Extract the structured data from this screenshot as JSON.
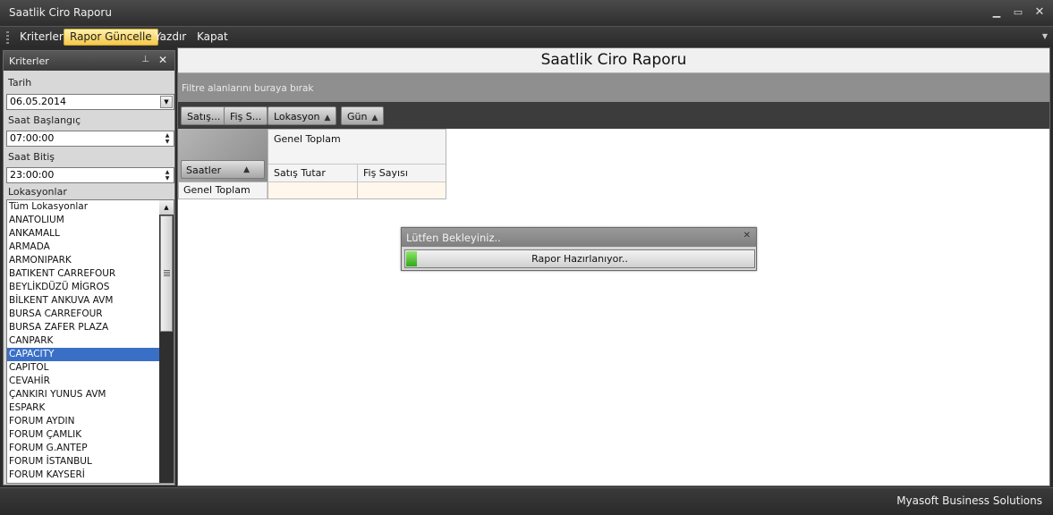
{
  "window": {
    "title": "Saatlik Ciro Raporu"
  },
  "menu": {
    "items": [
      {
        "label": "Kriterler",
        "active": false
      },
      {
        "label": "Rapor Güncelle",
        "active": true
      },
      {
        "label": "Yazdır",
        "active": false
      },
      {
        "label": "Kapat",
        "active": false
      }
    ]
  },
  "criteria": {
    "panel_title": "Kriterler",
    "date_label": "Tarih",
    "date_value": "06.05.2014",
    "start_label": "Saat Başlangıç",
    "start_value": "07:00:00",
    "end_label": "Saat Bitiş",
    "end_value": "23:00:00",
    "locations_label": "Lokasyonlar",
    "locations": [
      "Tüm Lokasyonlar",
      "ANATOLIUM",
      "ANKAMALL",
      "ARMADA",
      "ARMONIPARK",
      "BATIKENT CARREFOUR",
      "BEYLİKDÜZÜ MİGROS",
      "BİLKENT ANKUVA AVM",
      "BURSA CARREFOUR",
      "BURSA ZAFER PLAZA",
      "CANPARK",
      "CAPACITY",
      "CAPITOL",
      "CEVAHİR",
      "ÇANKIRI YUNUS AVM",
      "ESPARK",
      "FORUM AYDIN",
      "FORUM ÇAMLIK",
      "FORUM G.ANTEP",
      "FORUM İSTANBUL",
      "FORUM KAYSERİ"
    ],
    "selected_location": "CAPACITY"
  },
  "report": {
    "title": "Saatlik Ciro Raporu",
    "filter_hint": "Filtre alanlarını buraya bırak",
    "column_fields": [
      "Satış...",
      "Fiş S...",
      "Lokasyon",
      "Gün"
    ],
    "row_field": "Saatler",
    "grand_total_col": "Genel Toplam",
    "measure_1": "Satış Tutar",
    "measure_2": "Fiş Sayısı",
    "grand_total_row": "Genel Toplam"
  },
  "progress": {
    "title": "Lütfen Bekleyiniz..",
    "text": "Rapor Hazırlanıyor..",
    "percent": 3
  },
  "status": {
    "company": "Myasoft Business Solutions"
  }
}
